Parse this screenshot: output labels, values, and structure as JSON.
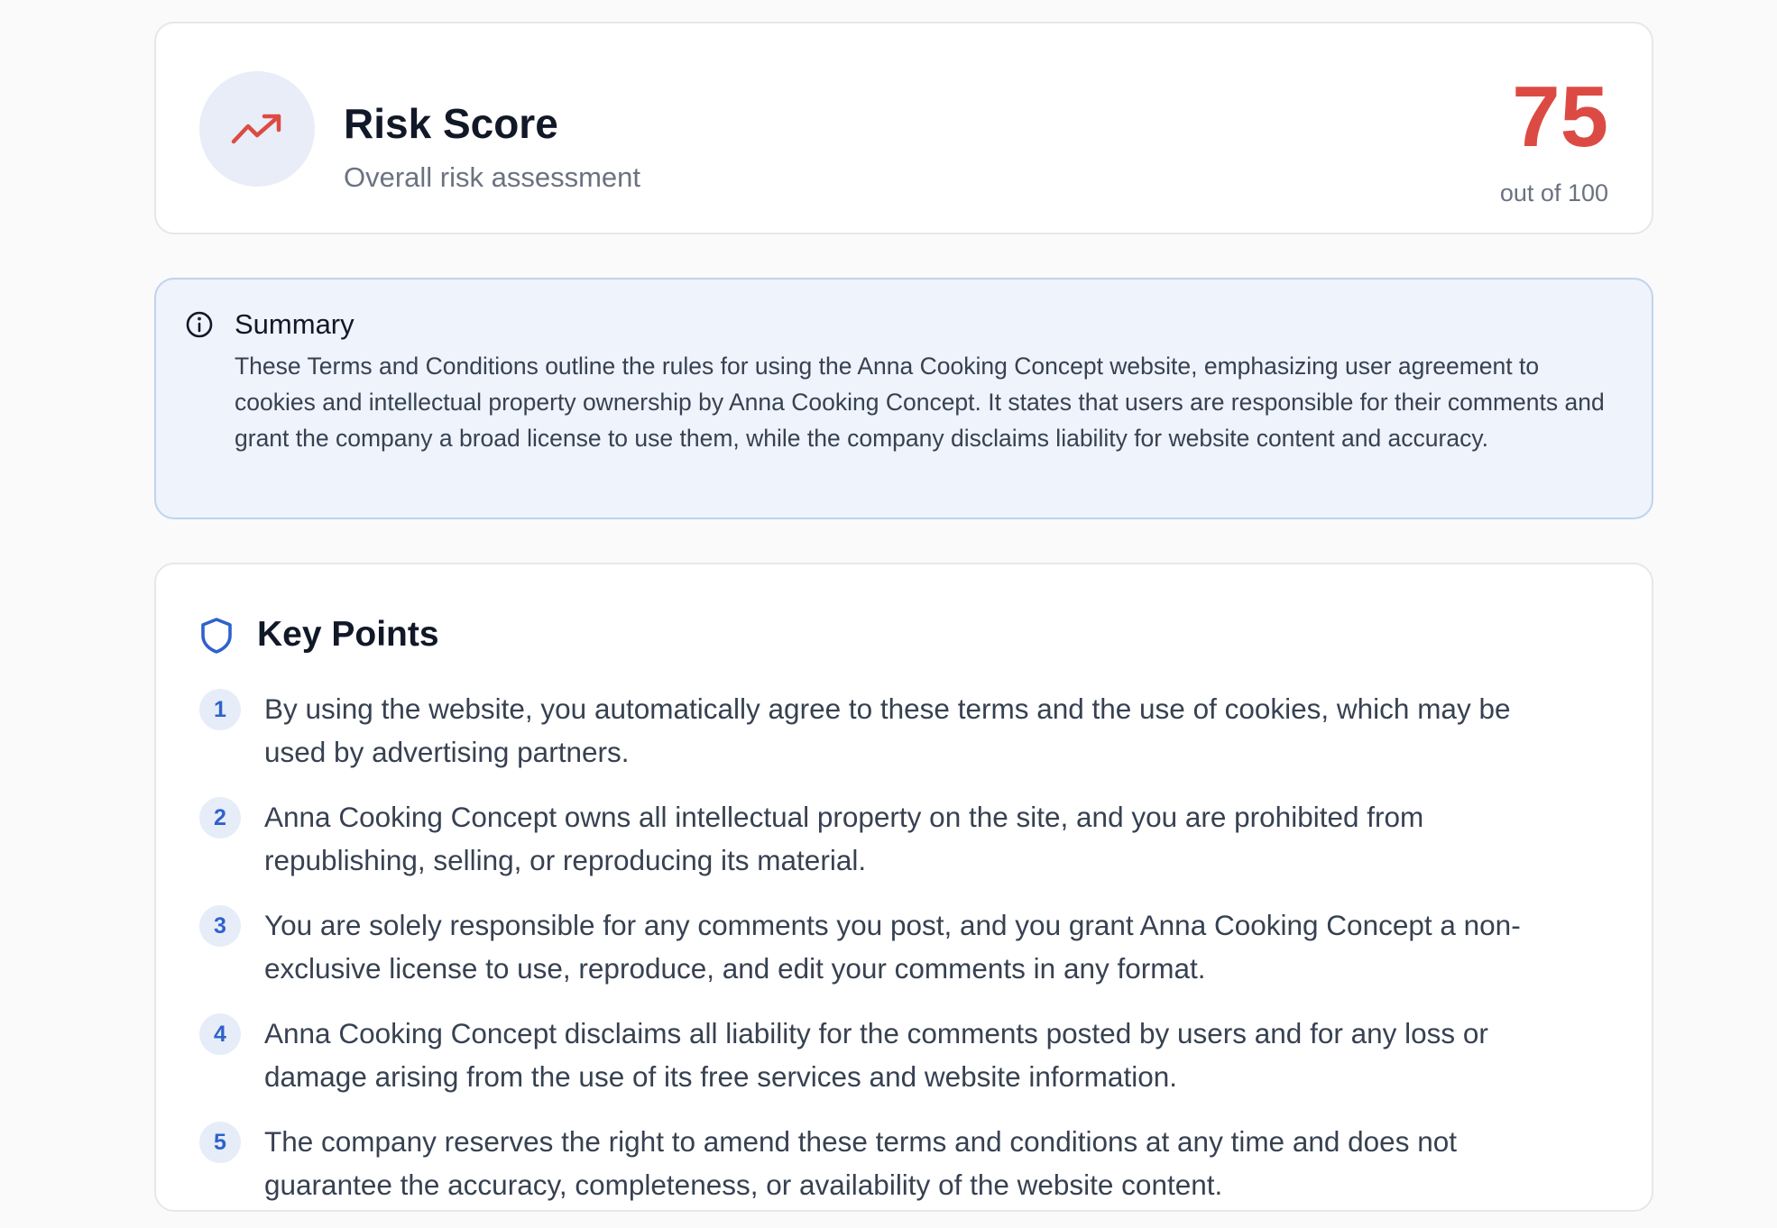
{
  "risk": {
    "title": "Risk Score",
    "subtitle": "Overall risk assessment",
    "score": "75",
    "scale": "out of 100",
    "score_color": "#dc4b43",
    "icon": "trending-up-icon"
  },
  "summary": {
    "title": "Summary",
    "icon": "info-icon",
    "text": "These Terms and Conditions outline the rules for using the Anna Cooking Concept website, emphasizing user agreement to cookies and intellectual property ownership by Anna Cooking Concept. It states that users are responsible for their comments and grant the company a broad license to use them, while the company disclaims liability for website content and accuracy."
  },
  "key_points": {
    "title": "Key Points",
    "icon": "shield-icon",
    "accent_color": "#2f62cc",
    "items": [
      {
        "number": "1",
        "text": "By using the website, you automatically agree to these terms and the use of cookies, which may be used by advertising partners."
      },
      {
        "number": "2",
        "text": "Anna Cooking Concept owns all intellectual property on the site, and you are prohibited from republishing, selling, or reproducing its material."
      },
      {
        "number": "3",
        "text": "You are solely responsible for any comments you post, and you grant Anna Cooking Concept a non-exclusive license to use, reproduce, and edit your comments in any format."
      },
      {
        "number": "4",
        "text": "Anna Cooking Concept disclaims all liability for the comments posted by users and for any loss or damage arising from the use of its free services and website information."
      },
      {
        "number": "5",
        "text": "The company reserves the right to amend these terms and conditions at any time and does not guarantee the accuracy, completeness, or availability of the website content."
      }
    ]
  }
}
